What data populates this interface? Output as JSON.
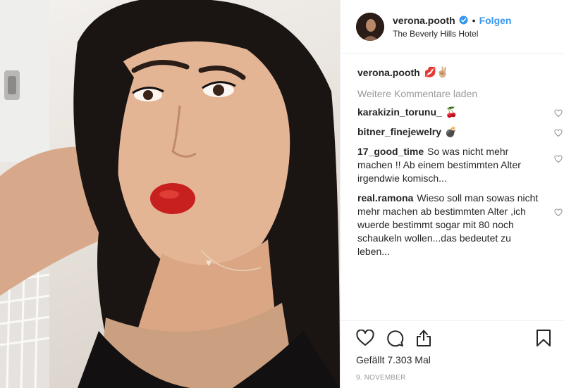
{
  "header": {
    "username": "verona.pooth",
    "separator": "•",
    "follow_label": "Folgen",
    "location": "The Beverly Hills Hotel"
  },
  "caption": {
    "username": "verona.pooth",
    "text": "💋✌🏼"
  },
  "load_more": "Weitere Kommentare laden",
  "comments": [
    {
      "user": "karakizin_torunu_",
      "text": "🍒"
    },
    {
      "user": "bitner_finejewelry",
      "text": "💣"
    },
    {
      "user": "17_good_time",
      "text": "So was nicht mehr machen !! Ab einem bestimmten Alter irgendwie komisch..."
    },
    {
      "user": "real.ramona",
      "text": "Wieso soll man sowas nicht mehr machen ab bestimmten Alter ,ich wuerde bestimmt sogar mit 80 noch schaukeln wollen...das bedeutet zu leben..."
    }
  ],
  "likes": "Gefällt 7.303 Mal",
  "date": "9. NOVEMBER",
  "colors": {
    "link_blue": "#3897f0",
    "verified_blue": "#3897f0",
    "muted_grey": "#999999",
    "text": "#262626"
  },
  "icons": [
    "verified-badge-icon",
    "heart-icon",
    "comment-icon",
    "share-icon",
    "bookmark-icon"
  ]
}
